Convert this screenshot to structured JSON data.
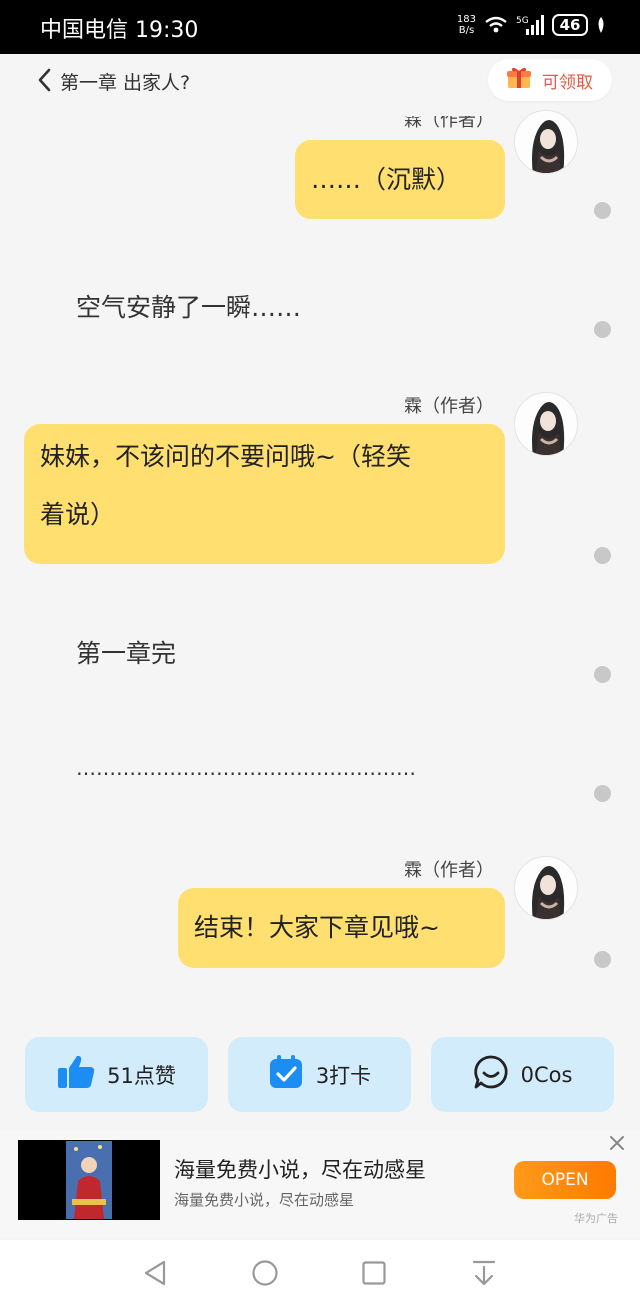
{
  "status_bar": {
    "carrier": "中国电信",
    "time": "19:30",
    "net_speed_value": "183",
    "net_speed_unit": "B/s",
    "network": "5G",
    "battery": "46",
    "icons": [
      "wifi-icon",
      "signal-icon",
      "battery-icon",
      "leaf-icon"
    ]
  },
  "header": {
    "chapter_title": "第一章 出家人?",
    "reward_label": "可领取",
    "icons": [
      "back-arrow-icon",
      "gift-box-icon"
    ]
  },
  "chat": {
    "messages": [
      {
        "type": "author",
        "author": "霖（作者）",
        "text": "……（沉默）"
      },
      {
        "type": "narration",
        "text": "空气安静了一瞬……"
      },
      {
        "type": "author",
        "author": "霖（作者）",
        "text_line1": "妹妹，不该问的不要问哦~（轻笑",
        "text_line2": "着说）"
      },
      {
        "type": "narration",
        "text": "第一章完"
      },
      {
        "type": "narration",
        "text": "……………………………………………"
      },
      {
        "type": "author",
        "author": "霖（作者）",
        "text": "结束！大家下章见哦~"
      }
    ]
  },
  "actions": {
    "like_label": "51点赞",
    "checkin_label": "3打卡",
    "cos_label": "0Cos",
    "icons": [
      "thumbs-up-icon",
      "calendar-check-icon",
      "chat-bubble-icon"
    ]
  },
  "ad": {
    "title": "海量免费小说，尽在动感星",
    "subtitle": "海量免费小说，尽在动感星",
    "open_label": "OPEN",
    "source": "华为广告",
    "icons": [
      "close-icon"
    ]
  },
  "nav_bar": {
    "icons": [
      "back-triangle-icon",
      "home-circle-icon",
      "recent-square-icon",
      "download-icon"
    ]
  },
  "colors": {
    "bubble": "#ffdf70",
    "action_bg": "#d3ecfc",
    "like_icon": "#1c8df2",
    "reward_text": "#e35a45",
    "open_button": "#ff8a10"
  }
}
